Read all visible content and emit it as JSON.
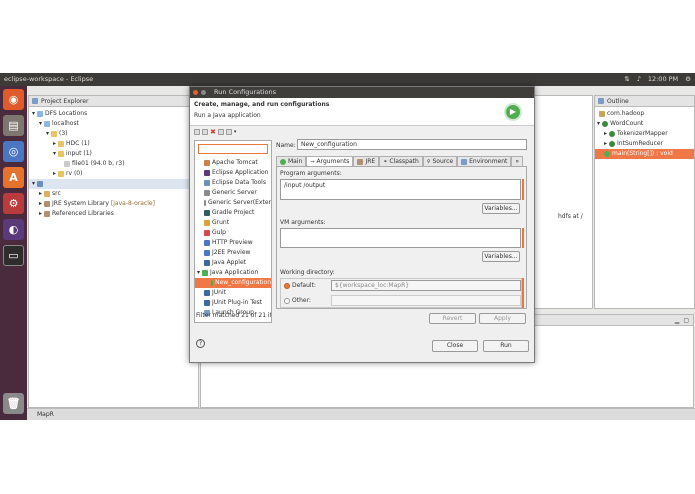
{
  "system": {
    "window_title": "eclipse-workspace - Eclipse",
    "clock": "12:00 PM"
  },
  "colors": {
    "accent": "#f07746",
    "panel_bg": "#f0f0f0",
    "launcher": "#4a2a3d"
  },
  "launcher": {
    "icons": [
      "ubuntu-logo-icon",
      "files-icon",
      "chrome-icon",
      "software-center-icon",
      "settings-icon",
      "eclipse-icon",
      "terminal-icon",
      "trash-icon"
    ]
  },
  "explorer": {
    "tab": "Project Explorer",
    "items": [
      "DFS Locations",
      "localhost",
      "(3)",
      "HDC (1)",
      "input (1)",
      "file01 (94.0 b, r3)",
      "rv (0)",
      "src",
      "JRE System Library",
      "[java-8-oracle]",
      "Referenced Libraries"
    ]
  },
  "editor": {
    "fragment": "hdfs at /"
  },
  "outline": {
    "tab": "Outline",
    "items": [
      "com.hadoop",
      "WordCount",
      "TokenizerMapper",
      "IntSumReducer",
      "main(String[]) : void"
    ]
  },
  "status": {
    "text": "MapR"
  },
  "dialog": {
    "title": "Run Configurations",
    "heading": "Create, manage, and run configurations",
    "subheading": "Run a Java application",
    "filter_status": "Filter matched 21 of 21 ite",
    "tree": [
      {
        "label": "Apache Tomcat",
        "kind": "tomcat"
      },
      {
        "label": "Eclipse Application",
        "kind": "eclipse"
      },
      {
        "label": "Eclipse Data Tools",
        "kind": "data"
      },
      {
        "label": "Generic Server",
        "kind": "server"
      },
      {
        "label": "Generic Server(Exter",
        "kind": "server"
      },
      {
        "label": "Gradle Project",
        "kind": "gradle"
      },
      {
        "label": "Grunt",
        "kind": "grunt"
      },
      {
        "label": "Gulp",
        "kind": "gulp"
      },
      {
        "label": "HTTP Preview",
        "kind": "http"
      },
      {
        "label": "J2EE Preview",
        "kind": "j2ee"
      },
      {
        "label": "Java Applet",
        "kind": "applet"
      },
      {
        "label": "Java Application",
        "kind": "javaapp"
      },
      {
        "label": "New_configuration",
        "kind": "config"
      },
      {
        "label": "JUnit",
        "kind": "junit"
      },
      {
        "label": "JUnit Plug-in Test",
        "kind": "junit"
      },
      {
        "label": "Launch Group",
        "kind": "launch"
      }
    ],
    "name_label": "Name:",
    "name_value": "New_configuration",
    "tabs": [
      "Main",
      "Arguments",
      "JRE",
      "Classpath",
      "Source",
      "Environment",
      "»"
    ],
    "program_args_label": "Program arguments:",
    "program_args_value": "/input /output",
    "variables_label": "Variables...",
    "vm_args_label": "VM arguments:",
    "working_dir_label": "Working directory:",
    "default_label": "Default:",
    "default_value": "${workspace_loc:MapR}",
    "other_label": "Other:",
    "revert_label": "Revert",
    "apply_label": "Apply",
    "close_label": "Close",
    "run_label": "Run"
  }
}
